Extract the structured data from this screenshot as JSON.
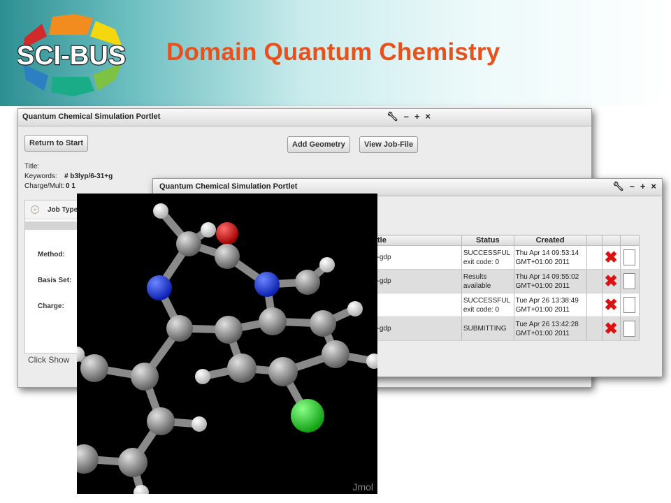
{
  "header": {
    "title": "Domain Quantum Chemistry",
    "logo_text": "SCI-BUS",
    "logo_colors": [
      "#d12a2a",
      "#f28c1f",
      "#f4d80d",
      "#7dc242",
      "#1aab87",
      "#2c7fc1"
    ]
  },
  "portlet_back": {
    "title": "Quantum Chemical Simulation Portlet",
    "controls": [
      "wrench-icon",
      "minimize-icon",
      "maximize-icon",
      "close-icon"
    ],
    "buttons": {
      "return": "Return to Start",
      "add_geometry": "Add Geometry",
      "view_job": "View Job-File"
    },
    "fields": {
      "title_label": "Title:",
      "keywords_label": "Keywords:",
      "keywords_value": "# b3lyp/6-31+g",
      "charge_label": "Charge/Mult:",
      "charge_value": "0 1"
    },
    "job_type": "Job Type",
    "form": {
      "method": "Method:",
      "basis": "Basis Set:",
      "charge": "Charge:"
    },
    "footer_text": "Click Show"
  },
  "portlet_front": {
    "title": "Quantum Chemical Simulation Portlet",
    "table": {
      "headers": [
        "tle",
        "Status",
        "Created"
      ],
      "rows": [
        {
          "name": "-gdp",
          "status": [
            "SUCCESSFUL",
            "exit code: 0"
          ],
          "created": [
            "Thu Apr 14 09:53:14",
            "GMT+01:00 2011"
          ]
        },
        {
          "name": "-gdp",
          "status": [
            "Results",
            "available"
          ],
          "created": [
            "Thu Apr 14 09:55:02",
            "GMT+01:00 2011"
          ]
        },
        {
          "name": "",
          "status": [
            "SUCCESSFUL",
            "exit code: 0"
          ],
          "created": [
            "Tue Apr 26 13:38:49",
            "GMT+01:00 2011"
          ]
        },
        {
          "name": "-gdp",
          "status": [
            "SUBMITTING",
            ""
          ],
          "created": [
            "Tue Apr 26 13:42:28",
            "GMT+01:00 2011"
          ]
        }
      ]
    }
  },
  "viewer": {
    "label": "Jmol",
    "atom_colors": {
      "carbon": "#8c8c8c",
      "hydrogen": "#eeeeee",
      "nitrogen": "#1b3fe0",
      "oxygen": "#e00000",
      "chlorine": "#22d622"
    }
  }
}
